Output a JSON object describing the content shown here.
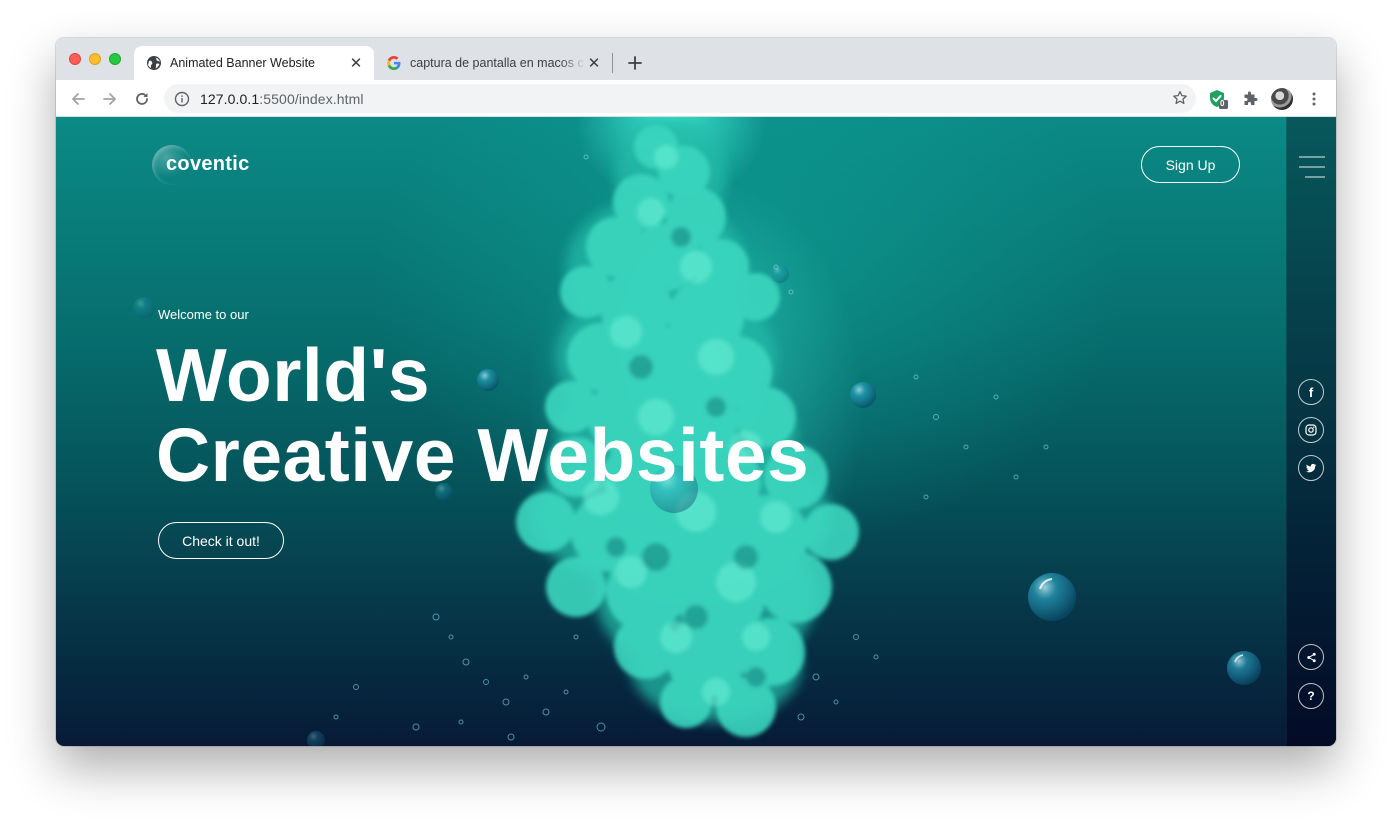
{
  "browser": {
    "tabs": [
      {
        "title": "Animated Banner Website",
        "favicon": "globe-icon",
        "active": true
      },
      {
        "title": "captura de pantalla en macos c",
        "favicon": "google-icon",
        "active": false
      }
    ],
    "url_host": "127.0.0.1",
    "url_rest": ":5500/index.html",
    "extension_badge": "0"
  },
  "site": {
    "logo": "coventic",
    "signup_label": "Sign Up",
    "welcome": "Welcome to our",
    "headline_line1": "World's",
    "headline_line2": "Creative Websites",
    "cta_label": "Check it out!",
    "social": [
      {
        "name": "facebook-icon",
        "glyph": "f"
      },
      {
        "name": "instagram-icon",
        "glyph": ""
      },
      {
        "name": "twitter-icon",
        "glyph": ""
      }
    ],
    "bottom_icons": [
      {
        "name": "share-icon",
        "glyph": ""
      },
      {
        "name": "help-icon",
        "glyph": "?"
      }
    ]
  },
  "colors": {
    "accent": "#0c8c86",
    "dark": "#071a36",
    "smoke": "#3fe0c7"
  }
}
